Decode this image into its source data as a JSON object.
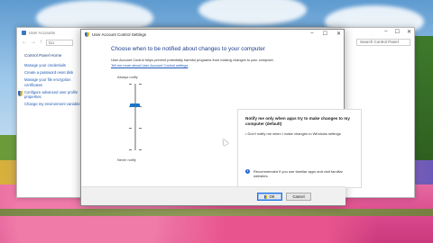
{
  "control_panel": {
    "title": "User Accounts",
    "address": "Co",
    "search_placeholder": "Search Control Panel",
    "sidebar_title": "Control Panel Home",
    "links": [
      "Manage your credentials",
      "Create a password reset disk",
      "Manage your file encryption certificates",
      "Configure advanced user profile properties",
      "Change my environment variables"
    ]
  },
  "uac": {
    "title": "User Account Control Settings",
    "heading": "Choose when to be notified about changes to your computer",
    "description": "User Account Control helps prevent potentially harmful programs from making changes to your computer.",
    "tell_me_link": "Tell me more about User Account Control settings",
    "slider": {
      "top_label": "Always notify",
      "bottom_label": "Never notify",
      "level": 2,
      "levels": 4
    },
    "info": {
      "title": "Notify me only when apps try to make changes to my computer (default)",
      "bullet": "Don't notify me when I make changes to Windows settings",
      "recommendation": "Recommended if you use familiar apps and visit familiar websites."
    },
    "buttons": {
      "ok": "OK",
      "cancel": "Cancel"
    }
  },
  "colors": {
    "heading": "#1e3f8c",
    "link": "#1f5ab5",
    "slider_thumb": "#1d74c9"
  }
}
